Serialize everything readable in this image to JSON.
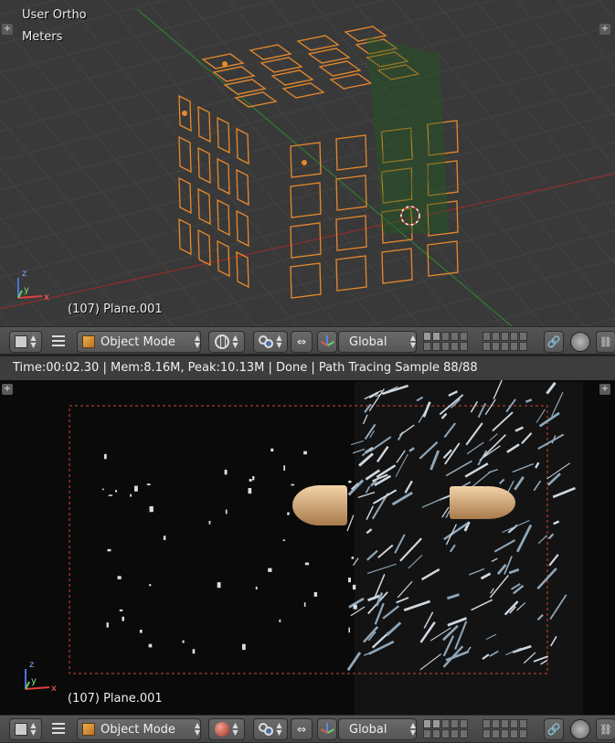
{
  "top_viewport": {
    "view_name": "User Ortho",
    "units": "Meters",
    "object_label": "(107) Plane.001"
  },
  "render_viewport": {
    "status": "Time:00:02.30 | Mem:8.16M, Peak:10.13M | Done | Path Tracing Sample 88/88",
    "object_label": "(107) Plane.001"
  },
  "header_top": {
    "mode_label": "Object Mode",
    "orientation_label": "Global"
  },
  "header_bottom": {
    "mode_label": "Object Mode",
    "orientation_label": "Global"
  },
  "axes": {
    "x": "x",
    "y": "y",
    "z": "z"
  },
  "colors": {
    "selection_orange": "#e8892b",
    "grid_green": "#2d8a2d",
    "grid_red": "#a02a2a",
    "viewport_bg": "#393939",
    "render_bg": "#0a0a0a"
  }
}
